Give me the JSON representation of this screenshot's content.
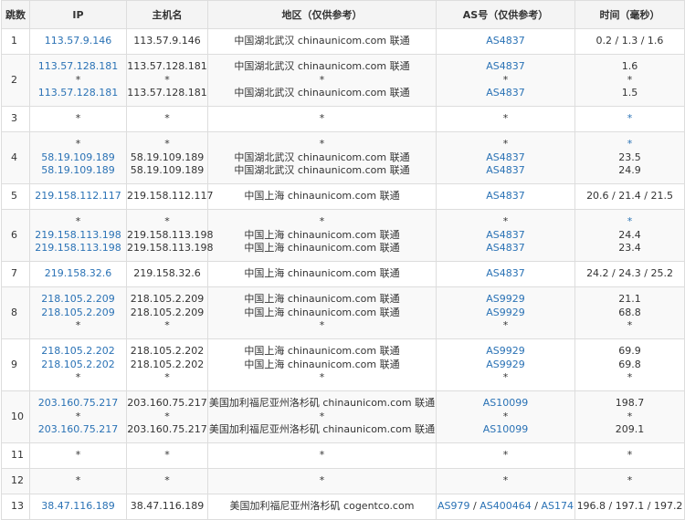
{
  "headers": {
    "hop": "跳数",
    "ip": "IP",
    "host": "主机名",
    "region": "地区（仅供参考）",
    "as": "AS号（仅供参考）",
    "time": "时间（毫秒）"
  },
  "rows": [
    {
      "hop": "1",
      "height": 28,
      "ips": [
        "113.57.9.146"
      ],
      "hosts": [
        "113.57.9.146"
      ],
      "regions": [
        "中国湖北武汉 chinaunicom.com 联通"
      ],
      "as": [
        [
          "AS4837"
        ]
      ],
      "times": [
        "0.2 / 1.3 / 1.6"
      ]
    },
    {
      "hop": "2",
      "height": 57,
      "ips": [
        "113.57.128.181",
        "*",
        "113.57.128.181"
      ],
      "hosts": [
        "113.57.128.181",
        "*",
        "113.57.128.181"
      ],
      "regions": [
        "中国湖北武汉 chinaunicom.com 联通",
        "*",
        "中国湖北武汉 chinaunicom.com 联通"
      ],
      "as": [
        [
          "AS4837"
        ],
        [
          "*"
        ],
        [
          "AS4837"
        ]
      ],
      "times": [
        "1.6",
        "*",
        "1.5"
      ]
    },
    {
      "hop": "3",
      "height": 28,
      "ips": [
        "*"
      ],
      "hosts": [
        "*"
      ],
      "regions": [
        "*"
      ],
      "as": [
        [
          "*"
        ]
      ],
      "times": [
        "*"
      ]
    },
    {
      "hop": "4",
      "height": 57,
      "ips": [
        "*",
        "58.19.109.189",
        "58.19.109.189"
      ],
      "hosts": [
        "*",
        "58.19.109.189",
        "58.19.109.189"
      ],
      "regions": [
        "*",
        "中国湖北武汉 chinaunicom.com 联通",
        "中国湖北武汉 chinaunicom.com 联通"
      ],
      "as": [
        [
          "*"
        ],
        [
          "AS4837"
        ],
        [
          "AS4837"
        ]
      ],
      "times": [
        "*",
        "23.5",
        "24.9"
      ]
    },
    {
      "hop": "5",
      "height": 28,
      "ips": [
        "219.158.112.117"
      ],
      "hosts": [
        "219.158.112.117"
      ],
      "regions": [
        "中国上海 chinaunicom.com 联通"
      ],
      "as": [
        [
          "AS4837"
        ]
      ],
      "times": [
        "20.6 / 21.4 / 21.5"
      ]
    },
    {
      "hop": "6",
      "height": 57,
      "ips": [
        "*",
        "219.158.113.198",
        "219.158.113.198"
      ],
      "hosts": [
        "*",
        "219.158.113.198",
        "219.158.113.198"
      ],
      "regions": [
        "*",
        "中国上海 chinaunicom.com 联通",
        "中国上海 chinaunicom.com 联通"
      ],
      "as": [
        [
          "*"
        ],
        [
          "AS4837"
        ],
        [
          "AS4837"
        ]
      ],
      "times": [
        "*",
        "24.4",
        "23.4"
      ]
    },
    {
      "hop": "7",
      "height": 28,
      "ips": [
        "219.158.32.6"
      ],
      "hosts": [
        "219.158.32.6"
      ],
      "regions": [
        "中国上海 chinaunicom.com 联通"
      ],
      "as": [
        [
          "AS4837"
        ]
      ],
      "times": [
        "24.2 / 24.3 / 25.2"
      ]
    },
    {
      "hop": "8",
      "height": 57,
      "ips": [
        "218.105.2.209",
        "218.105.2.209",
        "*"
      ],
      "hosts": [
        "218.105.2.209",
        "218.105.2.209",
        "*"
      ],
      "regions": [
        "中国上海 chinaunicom.com 联通",
        "中国上海 chinaunicom.com 联通",
        "*"
      ],
      "as": [
        [
          "AS9929"
        ],
        [
          "AS9929"
        ],
        [
          "*"
        ]
      ],
      "times": [
        "21.1",
        "68.8",
        "*"
      ]
    },
    {
      "hop": "9",
      "height": 57,
      "ips": [
        "218.105.2.202",
        "218.105.2.202",
        "*"
      ],
      "hosts": [
        "218.105.2.202",
        "218.105.2.202",
        "*"
      ],
      "regions": [
        "中国上海 chinaunicom.com 联通",
        "中国上海 chinaunicom.com 联通",
        "*"
      ],
      "as": [
        [
          "AS9929"
        ],
        [
          "AS9929"
        ],
        [
          "*"
        ]
      ],
      "times": [
        "69.9",
        "69.8",
        "*"
      ]
    },
    {
      "hop": "10",
      "height": 57,
      "ips": [
        "203.160.75.217",
        "*",
        "203.160.75.217"
      ],
      "hosts": [
        "203.160.75.217",
        "*",
        "203.160.75.217"
      ],
      "regions": [
        "美国加利福尼亚州洛杉矶 chinaunicom.com 联通",
        "*",
        "美国加利福尼亚州洛杉矶 chinaunicom.com 联通"
      ],
      "as": [
        [
          "AS10099"
        ],
        [
          "*"
        ],
        [
          "AS10099"
        ]
      ],
      "times": [
        "198.7",
        "*",
        "209.1"
      ]
    },
    {
      "hop": "11",
      "height": 28,
      "ips": [
        "*"
      ],
      "hosts": [
        "*"
      ],
      "regions": [
        "*"
      ],
      "as": [
        [
          "*"
        ]
      ],
      "times": [
        "*"
      ]
    },
    {
      "hop": "12",
      "height": 28,
      "ips": [
        "*"
      ],
      "hosts": [
        "*"
      ],
      "regions": [
        "*"
      ],
      "as": [
        [
          "*"
        ]
      ],
      "times": [
        "*"
      ]
    },
    {
      "hop": "13",
      "height": 28,
      "ips": [
        "38.47.116.189"
      ],
      "hosts": [
        "38.47.116.189"
      ],
      "regions": [
        "美国加利福尼亚州洛杉矶 cogentco.com"
      ],
      "as": [
        [
          "AS979",
          "AS400464",
          "AS174"
        ]
      ],
      "times": [
        "196.8 / 197.1 / 197.2"
      ]
    }
  ]
}
